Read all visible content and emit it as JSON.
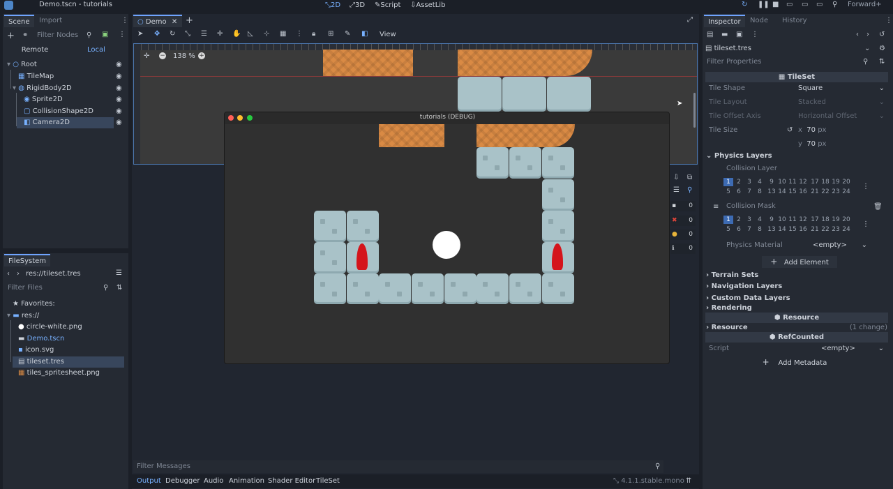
{
  "window": {
    "title": "Demo.tscn - tutorials",
    "renderer": "Forward+"
  },
  "workspaces": [
    {
      "icon": "2d-icon",
      "label": "2D"
    },
    {
      "icon": "3d-icon",
      "label": "3D"
    },
    {
      "icon": "script-icon",
      "label": "Script"
    },
    {
      "icon": "assetlib-icon",
      "label": "AssetLib"
    }
  ],
  "scene_panel": {
    "tabs": [
      "Scene",
      "Import"
    ],
    "filter_placeholder": "Filter Nodes",
    "remote": "Remote",
    "local": "Local",
    "nodes": [
      "Root",
      "TileMap",
      "RigidBody2D",
      "Sprite2D",
      "CollisionShape2D",
      "Camera2D"
    ]
  },
  "filesystem": {
    "tab": "FileSystem",
    "path": "res://tileset.tres",
    "filter_placeholder": "Filter Files",
    "favorites": "Favorites:",
    "root": "res://",
    "files": [
      "circle-white.png",
      "Demo.tscn",
      "icon.svg",
      "tileset.tres",
      "tiles_spritesheet.png"
    ]
  },
  "editor": {
    "tab": "Demo",
    "view_menu": "View",
    "zoom": "138 %"
  },
  "game_window": {
    "title": "tutorials (DEBUG)"
  },
  "debug_counts": [
    "0",
    "0",
    "0",
    "0"
  ],
  "bottom": {
    "filter_messages": "Filter Messages",
    "tabs": [
      "Output",
      "Debugger",
      "Audio",
      "Animation",
      "Shader Editor",
      "TileSet"
    ],
    "version": "4.1.1.stable.mono"
  },
  "inspector": {
    "tabs": [
      "Inspector",
      "Node",
      "History"
    ],
    "resource": "tileset.tres",
    "filter_placeholder": "Filter Properties",
    "class_name": "TileSet",
    "tile_shape_label": "Tile Shape",
    "tile_shape": "Square",
    "tile_layout_label": "Tile Layout",
    "tile_layout": "Stacked",
    "tile_offset_label": "Tile Offset Axis",
    "tile_offset": "Horizontal Offset",
    "tile_size_label": "Tile Size",
    "tile_size_x_label": "x",
    "tile_size_x": "70",
    "tile_size_y_label": "y",
    "tile_size_y": "70",
    "px_unit": "px",
    "physics_layers": "Physics Layers",
    "collision_layer": "Collision Layer",
    "collision_mask": "Collision Mask",
    "layer_row1": [
      "1",
      "2",
      "3",
      "4",
      "9",
      "10",
      "11",
      "12",
      "17",
      "18",
      "19",
      "20"
    ],
    "layer_row2": [
      "5",
      "6",
      "7",
      "8",
      "13",
      "14",
      "15",
      "16",
      "21",
      "22",
      "23",
      "24"
    ],
    "physics_material": "Physics Material",
    "empty": "<empty>",
    "add_element": "Add Element",
    "terrain_sets": "Terrain Sets",
    "navigation_layers": "Navigation Layers",
    "custom_data_layers": "Custom Data Layers",
    "rendering": "Rendering",
    "resource_header": "Resource",
    "resource_section": "Resource",
    "changes": "(1 change)",
    "refcounted": "RefCounted",
    "script_label": "Script",
    "script_value": "<empty>",
    "add_metadata": "Add Metadata"
  }
}
